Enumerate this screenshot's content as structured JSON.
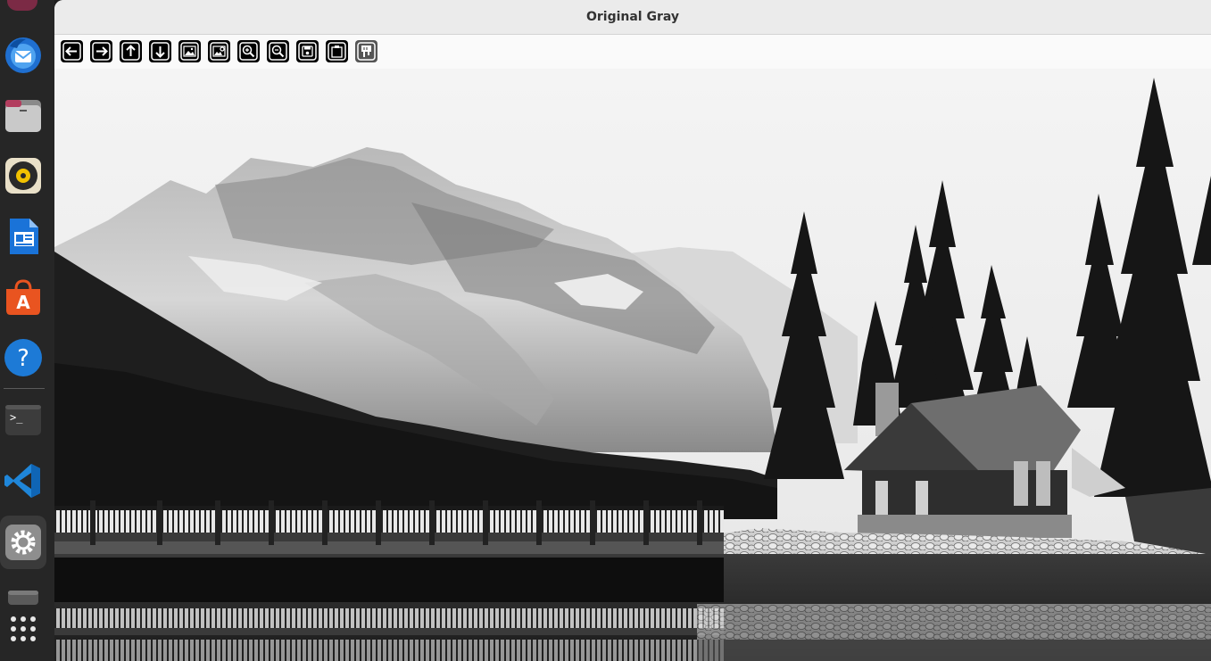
{
  "window": {
    "title": "Original Gray"
  },
  "toolbar": {
    "buttons": [
      {
        "icon": "arrow-left-icon",
        "tooltip": ""
      },
      {
        "icon": "arrow-right-icon",
        "tooltip": ""
      },
      {
        "icon": "arrow-up-icon",
        "tooltip": ""
      },
      {
        "icon": "arrow-down-icon",
        "tooltip": ""
      },
      {
        "icon": "image-icon",
        "tooltip": ""
      },
      {
        "icon": "image-settings-icon",
        "tooltip": ""
      },
      {
        "icon": "zoom-in-icon",
        "tooltip": ""
      },
      {
        "icon": "zoom-out-icon",
        "tooltip": ""
      },
      {
        "icon": "save-icon",
        "tooltip": ""
      },
      {
        "icon": "clipboard-icon",
        "tooltip": ""
      },
      {
        "icon": "properties-icon",
        "tooltip": ""
      }
    ]
  },
  "dock": {
    "items": [
      "thunderbird-icon",
      "files-icon",
      "rhythmbox-icon",
      "writer-icon",
      "app-center-icon",
      "help-icon",
      "terminal-icon",
      "vscode-icon",
      "settings-icon",
      "drive-icon",
      "app-grid-icon"
    ],
    "active": "settings-icon"
  },
  "image": {
    "description_colors": {
      "sky": "#f2f2f2",
      "mountain": "#9a9a9a",
      "forest": "#1e1e1e",
      "water": "#2a2a2a"
    }
  }
}
